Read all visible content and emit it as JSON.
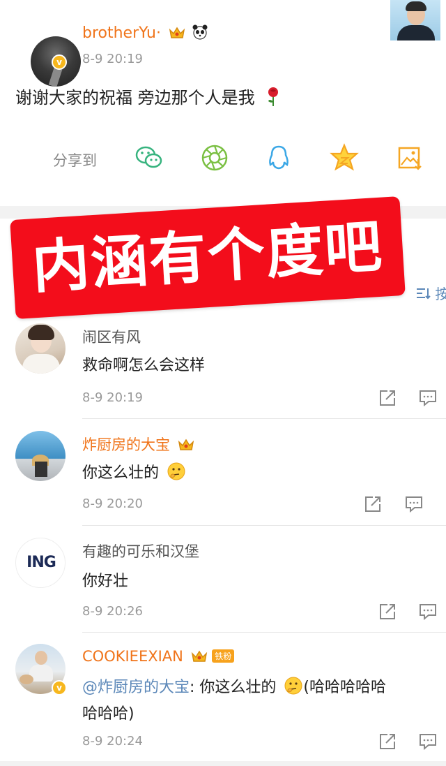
{
  "post": {
    "username": "brotherYu·",
    "time": "8-9 20:19",
    "text": "谢谢大家的祝福 旁边那个人是我",
    "share_label": "分享到"
  },
  "banner": {
    "text": "内涵有个度吧"
  },
  "sort": {
    "label": "按"
  },
  "comments": [
    {
      "name": "闹区有风",
      "text": "救命啊怎么会这样",
      "time": "8-9 20:19"
    },
    {
      "name": "炸厨房的大宝",
      "text": "你这么壮的",
      "time": "8-9 20:20"
    },
    {
      "name": "有趣的可乐和汉堡",
      "text": "你好壮",
      "time": "8-9 20:26",
      "avatar_text": "ING"
    },
    {
      "name": "COOKIEEXIAN",
      "badge": "铁粉",
      "mention": "@炸厨房的大宝",
      "text": ": 你这么壮的",
      "text_suffix": "(哈哈哈哈哈",
      "text_line2": "哈哈哈)",
      "time": "8-9 20:24"
    }
  ],
  "colors": {
    "accent_orange": "#f0741a",
    "banner_red": "#f30d1b",
    "link_blue": "#5b87b8",
    "meta_gray": "#999999"
  },
  "icons": [
    "verified-icon",
    "crown-icon",
    "panda-icon",
    "wechat-icon",
    "moments-icon",
    "qq-icon",
    "qzone-icon",
    "save-image-icon",
    "repost-icon",
    "reply-icon",
    "think-emoji-icon",
    "rose-emoji-icon"
  ]
}
